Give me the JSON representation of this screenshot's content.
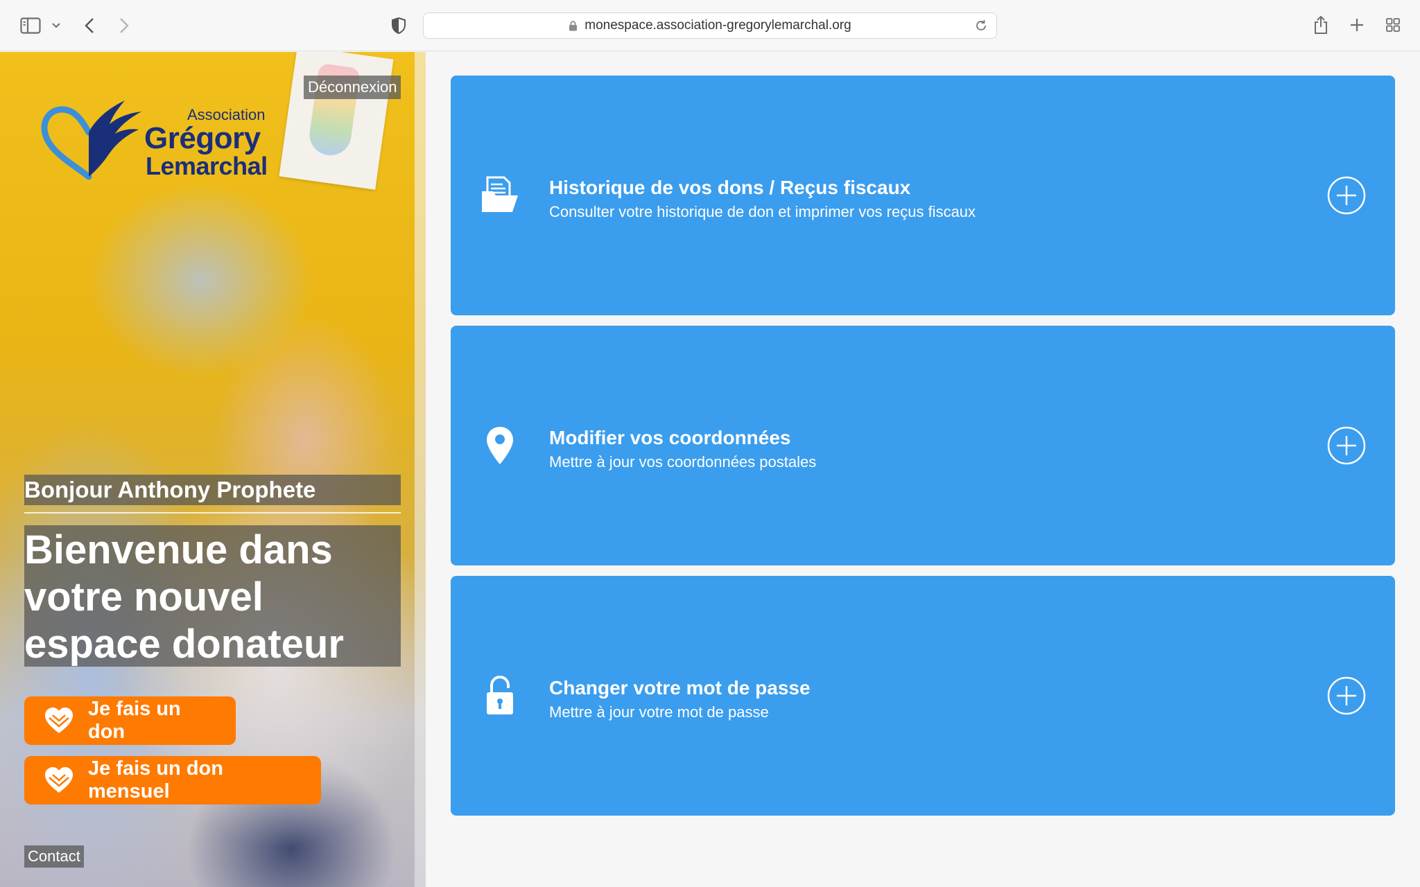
{
  "browser": {
    "url": "monespace.association-gregorylemarchal.org"
  },
  "logo": {
    "line1": "Association",
    "line2": "Grégory",
    "line3": "Lemarchal"
  },
  "header": {
    "logout_label": "Déconnexion"
  },
  "hero": {
    "greeting": "Bonjour Anthony Prophete",
    "welcome": "Bienvenue dans votre nouvel espace donateur",
    "donate_label": "Je fais un don",
    "monthly_donate_label": "Je fais un don mensuel",
    "contact_label": "Contact"
  },
  "cards": [
    {
      "title": "Historique de vos dons / Reçus fiscaux",
      "subtitle": "Consulter votre historique de don et imprimer vos reçus fiscaux",
      "icon": "folder-document-icon"
    },
    {
      "title": "Modifier vos coordonnées",
      "subtitle": "Mettre à jour vos coordonnées postales",
      "icon": "map-pin-icon"
    },
    {
      "title": "Changer votre mot de passe",
      "subtitle": "Mettre à jour votre mot de passe",
      "icon": "lock-icon"
    }
  ],
  "colors": {
    "card_blue": "#3b9ded",
    "donate_orange": "#ff7a00",
    "logo_navy": "#1a2f7a"
  }
}
